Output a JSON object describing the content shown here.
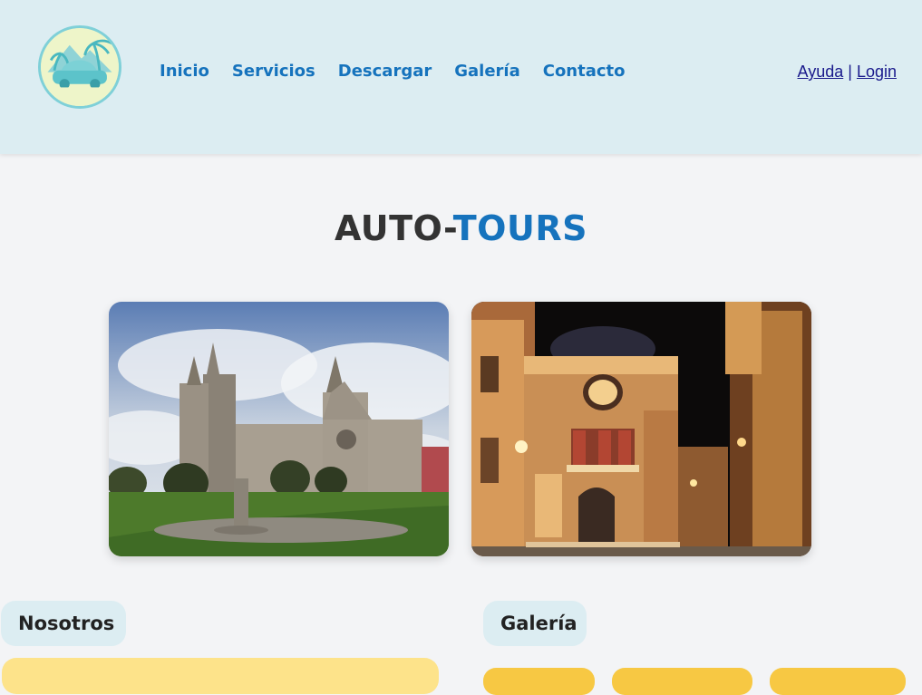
{
  "header": {
    "logo_icon": "car-palm-logo-icon",
    "nav": [
      {
        "label": "Inicio"
      },
      {
        "label": "Servicios"
      },
      {
        "label": "Descargar"
      },
      {
        "label": "Galería"
      },
      {
        "label": "Contacto"
      }
    ],
    "help_label": "Ayuda",
    "separator": "|",
    "login_label": "Login"
  },
  "hero": {
    "title_part1": "AUTO-",
    "title_part2": "TOURS"
  },
  "photos": [
    {
      "icon": "basilica-photo"
    },
    {
      "icon": "night-street-photo"
    }
  ],
  "sections": {
    "about_label": "Nosotros",
    "gallery_label": "Galería"
  },
  "colors": {
    "header_bg": "#dcedf2",
    "nav_link": "#1673bd",
    "title_dark": "#333333",
    "title_accent": "#1673bd",
    "yellow_box": "#fde38a",
    "chip": "#f7c843"
  }
}
